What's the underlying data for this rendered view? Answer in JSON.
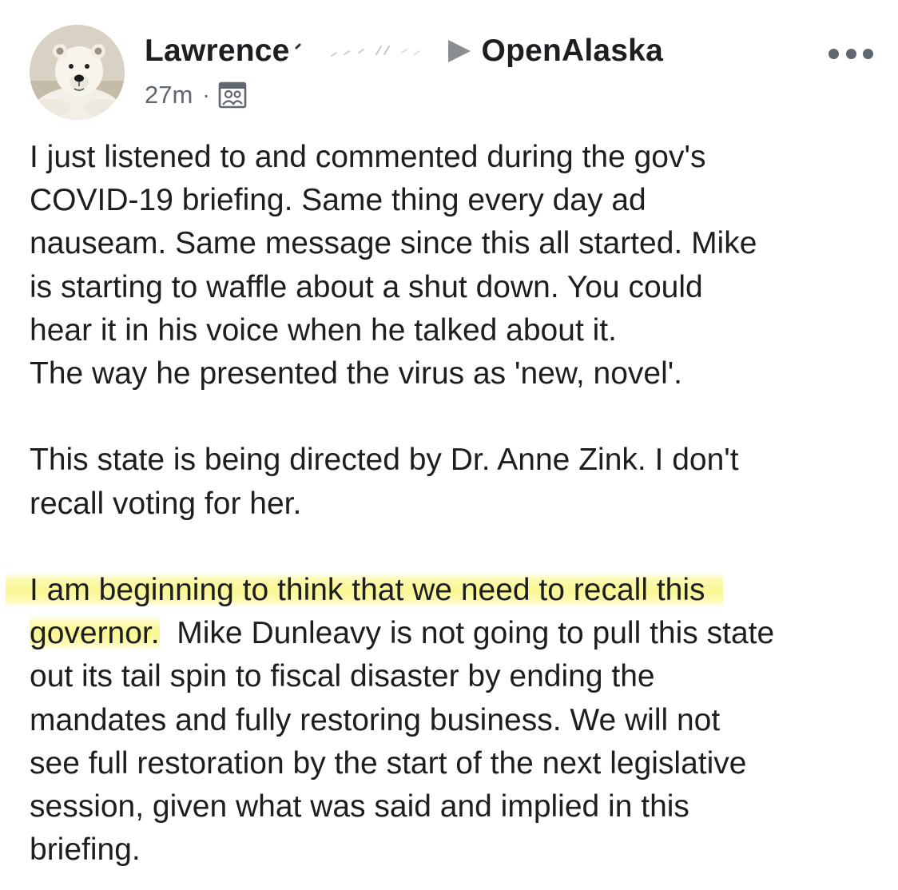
{
  "post": {
    "author": {
      "name": "Lawrence",
      "avatar_icon": "polar-bear-avatar"
    },
    "group": {
      "name": "OpenAlaska",
      "arrow_icon": "triangle-right-icon"
    },
    "meta": {
      "time": "27m",
      "separator": "·",
      "audience_icon": "group-members-icon"
    },
    "more_icon": "more-options-icon",
    "body": {
      "p1_lines": [
        "I just listened to and commented during the gov's",
        "COVID-19 briefing.  Same thing every day ad",
        "nauseam.  Same message since this all started.  Mike",
        "is starting to waffle about a shut down.  You could",
        "hear it in his voice when he talked about it.",
        "The way he presented the virus as 'new, novel'."
      ],
      "p2_lines": [
        "This state is being directed by Dr. Anne Zink.  I don't",
        "recall voting for her."
      ],
      "p3_highlight_line1": "I am beginning to think that we need to recall this",
      "p3_highlight_line2": "governor.",
      "p3_rest_line2": "  Mike Dunleavy is not going to pull this state",
      "p3_lines": [
        "out its tail spin to fiscal disaster by ending the",
        "mandates and fully restoring business.  We will not",
        "see full restoration by the start of the next legislative",
        "session, given what was said and implied in this",
        "briefing."
      ]
    },
    "highlight_color": "#f8f46e"
  }
}
